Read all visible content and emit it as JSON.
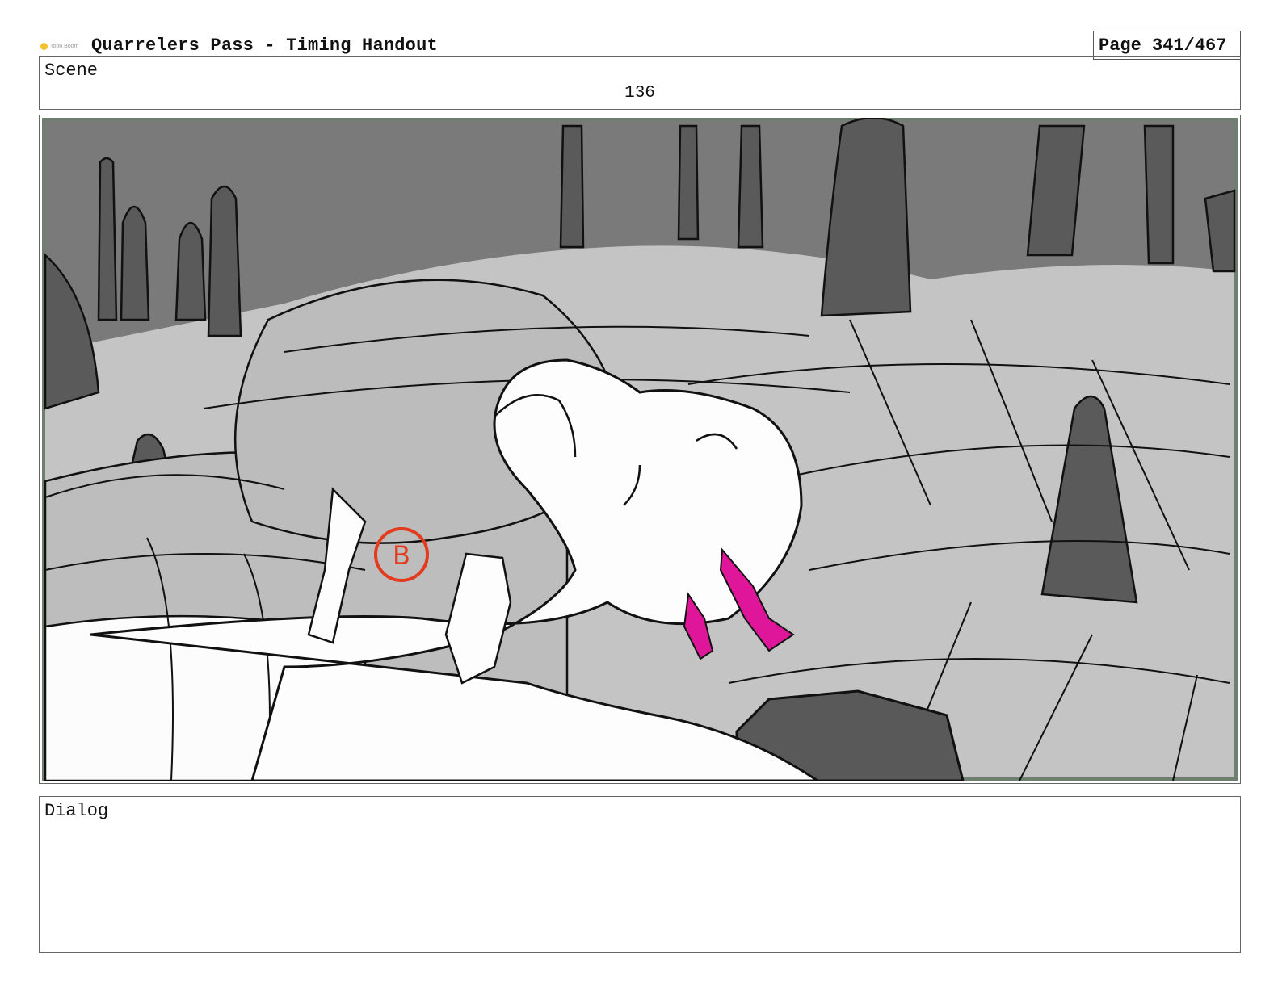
{
  "header": {
    "logo_text": "Toon Boom",
    "title": "Quarrelers Pass - Timing Handout",
    "page": "Page 341/467"
  },
  "scene": {
    "label": "Scene",
    "number": "136"
  },
  "panel": {
    "marker": "B"
  },
  "dialog": {
    "label": "Dialog",
    "text": ""
  }
}
